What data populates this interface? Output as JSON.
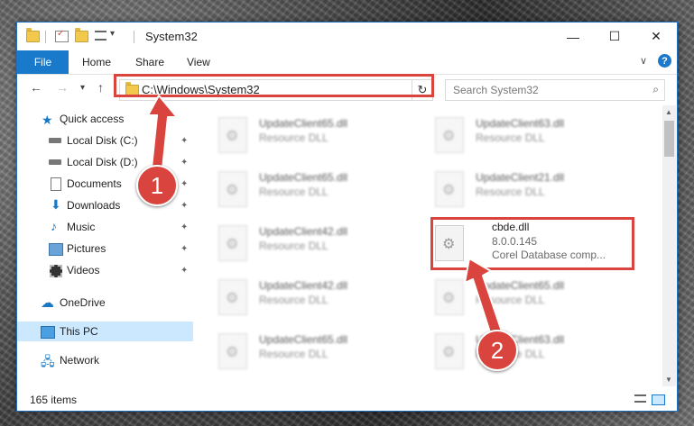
{
  "window": {
    "title": "System32",
    "minimize_label": "—",
    "maximize_label": "☐",
    "close_label": "✕"
  },
  "ribbon": {
    "tabs": [
      "File",
      "Home",
      "Share",
      "View"
    ],
    "expand_label": "∨",
    "help_label": "?"
  },
  "nav": {
    "back": "←",
    "forward": "→",
    "recent": "▾",
    "up": "↑",
    "address": "C:\\Windows\\System32",
    "address_dropdown": "∨",
    "refresh": "↻",
    "search_placeholder": "Search System32",
    "search_icon": "⌕"
  },
  "sidebar": {
    "items": [
      {
        "label": "Quick access",
        "icon": "star-icon",
        "pinned": false
      },
      {
        "label": "Local Disk (C:)",
        "icon": "drive-icon",
        "pinned": true
      },
      {
        "label": "Local Disk (D:)",
        "icon": "drive-icon",
        "pinned": true
      },
      {
        "label": "Documents",
        "icon": "document-icon",
        "pinned": true
      },
      {
        "label": "Downloads",
        "icon": "download-icon",
        "pinned": true
      },
      {
        "label": "Music",
        "icon": "music-icon",
        "pinned": true
      },
      {
        "label": "Pictures",
        "icon": "pictures-icon",
        "pinned": true
      },
      {
        "label": "Videos",
        "icon": "videos-icon",
        "pinned": true
      },
      {
        "label": "OneDrive",
        "icon": "cloud-icon",
        "pinned": false
      },
      {
        "label": "This PC",
        "icon": "computer-icon",
        "pinned": false,
        "selected": true
      },
      {
        "label": "Network",
        "icon": "network-icon",
        "pinned": false
      }
    ],
    "pin_glyph": "📌"
  },
  "files": [
    {
      "name": "UpdateClient65.dll",
      "type": "Resource DLL",
      "blurred": true
    },
    {
      "name": "UpdateClient63.dll",
      "type": "Resource DLL",
      "blurred": true
    },
    {
      "name": "UpdateClient65.dll",
      "type": "Resource DLL",
      "blurred": true
    },
    {
      "name": "UpdateClient21.dll",
      "type": "Resource DLL",
      "blurred": true
    },
    {
      "name": "UpdateClient42.dll",
      "type": "Resource DLL",
      "blurred": true
    },
    {
      "name": "cbde.dll",
      "type": "8.0.0.145",
      "company": "Corel Database comp...",
      "blurred": false,
      "highlighted": true
    },
    {
      "name": "UpdateClient42.dll",
      "type": "Resource DLL",
      "blurred": true
    },
    {
      "name": "UpdateClient65.dll",
      "type": "Resource DLL",
      "blurred": true
    },
    {
      "name": "UpdateClient65.dll",
      "type": "Resource DLL",
      "blurred": true
    },
    {
      "name": "UpdateClient63.dll",
      "type": "Resource DLL",
      "blurred": true
    }
  ],
  "status": {
    "item_count": "165 items"
  },
  "annotations": {
    "step1": "1",
    "step2": "2",
    "color": "#d9453e"
  }
}
